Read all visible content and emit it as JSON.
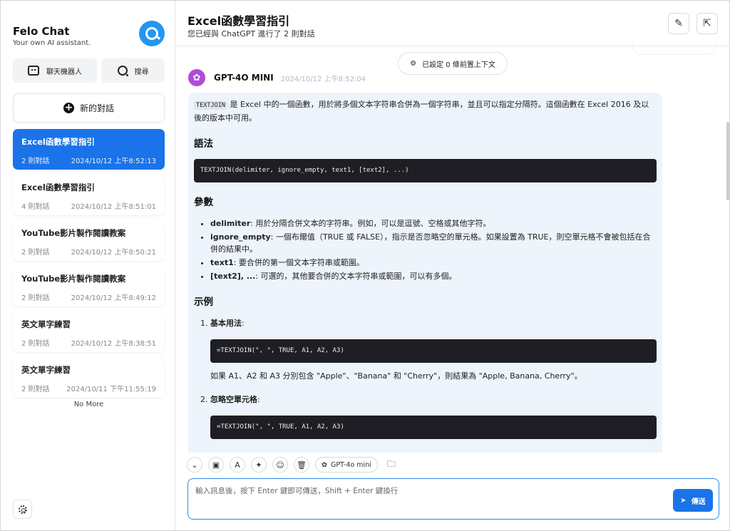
{
  "sidebar": {
    "app_name": "Felo Chat",
    "app_sub": "Your own AI assistant.",
    "robot_label": "聊天機器人",
    "search_label": "搜尋",
    "new_chat_label": "新的對話",
    "conversations": [
      {
        "title": "Excel函數學習指引",
        "count": "2 則對話",
        "time": "2024/10/12 上午8:52:13"
      },
      {
        "title": "Excel函數學習指引",
        "count": "4 則對話",
        "time": "2024/10/12 上午8:51:01"
      },
      {
        "title": "YouTube影片製作閱讀教案",
        "count": "2 則對話",
        "time": "2024/10/12 上午8:50:21"
      },
      {
        "title": "YouTube影片製作閱讀教案",
        "count": "2 則對話",
        "time": "2024/10/12 上午8:49:12"
      },
      {
        "title": "英文單字練習",
        "count": "2 則對話",
        "time": "2024/10/12 上午8:38:51"
      },
      {
        "title": "英文單字練習",
        "count": "2 則對話",
        "time": "2024/10/11 下午11:55:19"
      }
    ],
    "no_more": "No More"
  },
  "header": {
    "title": "Excel函數學習指引",
    "subtitle": "您已經與 ChatGPT 進行了 2 則對話"
  },
  "context_pill": "已設定 0 條前置上下文",
  "message": {
    "model": "GPT-4O MINI",
    "time": "2024/10/12 上午8:52:04",
    "intro_code": "TEXTJOIN",
    "intro_text": " 是 Excel 中的一個函數，用於將多個文本字符串合併為一個字符串，並且可以指定分隔符。這個函數在 Excel 2016 及以後的版本中可用。",
    "syntax_heading": "語法",
    "syntax_code": "TEXTJOIN(delimiter, ignore_empty, text1, [text2], ...)",
    "params_heading": "參數",
    "params": [
      {
        "name": "delimiter",
        "desc": ": 用於分隔合併文本的字符串。例如，可以是逗號、空格或其他字符。"
      },
      {
        "name": "ignore_empty",
        "desc": ": 一個布爾值（TRUE 或 FALSE），指示是否忽略空的單元格。如果設置為 TRUE，則空單元格不會被包括在合併的結果中。"
      },
      {
        "name": "text1",
        "desc": ": 要合併的第一個文本字符串或範圍。"
      },
      {
        "name": "[text2], ...",
        "desc": ": 可選的，其他要合併的文本字符串或範圍，可以有多個。"
      }
    ],
    "example_heading": "示例",
    "examples": [
      {
        "label": "基本用法",
        "code": "=TEXTJOIN(\", \", TRUE, A1, A2, A3)",
        "text": "如果 A1、A2 和 A3 分別包含 \"Apple\"、\"Banana\" 和 \"Cherry\"，則結果為 \"Apple, Banana, Cherry\"。"
      },
      {
        "label": "忽略空單元格",
        "code": "=TEXTJOIN(\", \", TRUE, A1, A2, A3)",
        "text": ""
      }
    ]
  },
  "toolbar": {
    "model_label": "GPT-4o mini"
  },
  "input": {
    "placeholder": "輸入訊息後，按下 Enter 鍵即可傳送，Shift + Enter 鍵換行",
    "send_label": "傳送"
  },
  "colors": {
    "accent": "#1a73e8",
    "message_bg": "#eef4fb",
    "code_bg": "#1e1e24"
  }
}
